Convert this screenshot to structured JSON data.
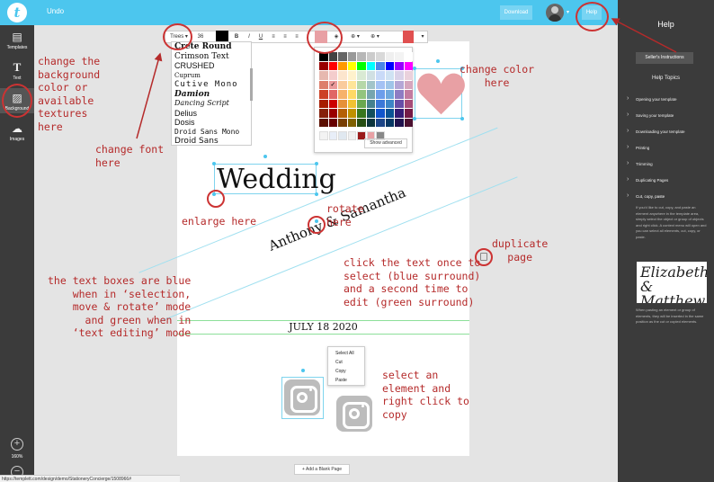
{
  "topbar": {
    "logo_letter": "t",
    "undo": "Undo",
    "download": "Download",
    "help": "Help"
  },
  "left_sidebar": {
    "items": [
      {
        "label": "Templates",
        "icon": "templates-icon"
      },
      {
        "label": "Text",
        "icon": "text-icon"
      },
      {
        "label": "Background",
        "icon": "background-icon"
      },
      {
        "label": "Images",
        "icon": "images-icon"
      }
    ],
    "zoom": "160%"
  },
  "toolbar": {
    "font": "Trees",
    "size": "36",
    "bold": "B",
    "italic": "I",
    "underline": "U"
  },
  "font_menu": [
    "Crete Round",
    "Crimson Text",
    "CRUSHED",
    "Cuprum",
    "Cutive Mono",
    "Damion",
    "Dancing Script",
    "Delius",
    "Dosis",
    "Droid Sans Mono",
    "Droid Sans"
  ],
  "color_panel": {
    "show_advanced": "Show advanced",
    "swatches": [
      "#000000",
      "#434343",
      "#666666",
      "#999999",
      "#b7b7b7",
      "#cccccc",
      "#d9d9d9",
      "#efefef",
      "#f3f3f3",
      "#ffffff",
      "#980000",
      "#ff0000",
      "#ff9900",
      "#ffff00",
      "#00ff00",
      "#00ffff",
      "#4a86e8",
      "#0000ff",
      "#9900ff",
      "#ff00ff",
      "#e6b8af",
      "#f4cccc",
      "#fce5cd",
      "#fff2cc",
      "#d9ead3",
      "#d0e0e3",
      "#c9daf8",
      "#cfe2f3",
      "#d9d2e9",
      "#ead1dc",
      "#dd7e6b",
      "#ea9999",
      "#f9cb9c",
      "#ffe599",
      "#b6d7a8",
      "#a2c4c9",
      "#a4c2f4",
      "#9fc5e8",
      "#b4a7d6",
      "#d5a6bd",
      "#cc4125",
      "#e06666",
      "#f6b26b",
      "#ffd966",
      "#93c47d",
      "#76a5af",
      "#6d9eeb",
      "#6fa8dc",
      "#8e7cc3",
      "#c27ba0",
      "#a61c00",
      "#cc0000",
      "#e69138",
      "#f1c232",
      "#6aa84f",
      "#45818e",
      "#3c78d8",
      "#3d85c6",
      "#674ea7",
      "#a64d79",
      "#85200c",
      "#990000",
      "#b45f06",
      "#bf9000",
      "#38761d",
      "#134f5c",
      "#1155cc",
      "#0b5394",
      "#351c75",
      "#741b47",
      "#5b0f00",
      "#660000",
      "#783f04",
      "#7f6000",
      "#274e13",
      "#0c343d",
      "#1c4587",
      "#073763",
      "#20124d",
      "#4c1130"
    ],
    "recent": [
      "#f3f3f3",
      "#e8eef8",
      "#e0e8f0",
      "#f0f0f0",
      "#9a1a1a",
      "#e8a0a4",
      "#888888"
    ]
  },
  "document": {
    "title": "Wedding",
    "names": "Anthony & Samantha",
    "date": "JULY 18 2020"
  },
  "context_menu": [
    "Select All",
    "Cut",
    "Copy",
    "Paste"
  ],
  "add_page": "+ Add a Blank Page",
  "help_panel": {
    "title": "Help",
    "sellers_instructions": "Seller's Instructions",
    "topics_heading": "Help Topics",
    "topics": [
      "Opening your template",
      "Saving your template",
      "Downloading your template",
      "Printing",
      "Trimming",
      "Duplicating Pages",
      "Cut, copy, paste"
    ],
    "paragraph1": "If you'd like to cut, copy, and paste an element anywhere in the template area, simply select the object or group of objects and right click. A context menu will open and you can select all elements, cut, copy, or paste.",
    "sample_text": "Elizabeth & Matthew",
    "paragraph2": "When pasting an element or group of elements, they will be inserted in the same position as the cut or copied elements."
  },
  "annotations": {
    "background": "change the\nbackground\ncolor or\navailable\ntextures\nhere",
    "font": "change font\nhere",
    "color": "change color\nhere",
    "enlarge": "enlarge here",
    "rotate": "rotate\nhere",
    "duplicate": "duplicate\npage",
    "click": "click the text once to\nselect (blue surround)\nand a second time to\nedit (green surround)",
    "modes": "the text boxes are blue\nwhen in ‘selection,\nmove & rotate’ mode\nand green when in\n‘text editing’ mode",
    "copy": "select an\nelement and\nright click to\ncopy"
  },
  "status_url": "https://templett.com/design/demo/StationeryConcierge/1508966#",
  "colors": {
    "accent": "#4cc6ee",
    "annotation": "#b52a2a",
    "heart": "#e8a0a4"
  }
}
